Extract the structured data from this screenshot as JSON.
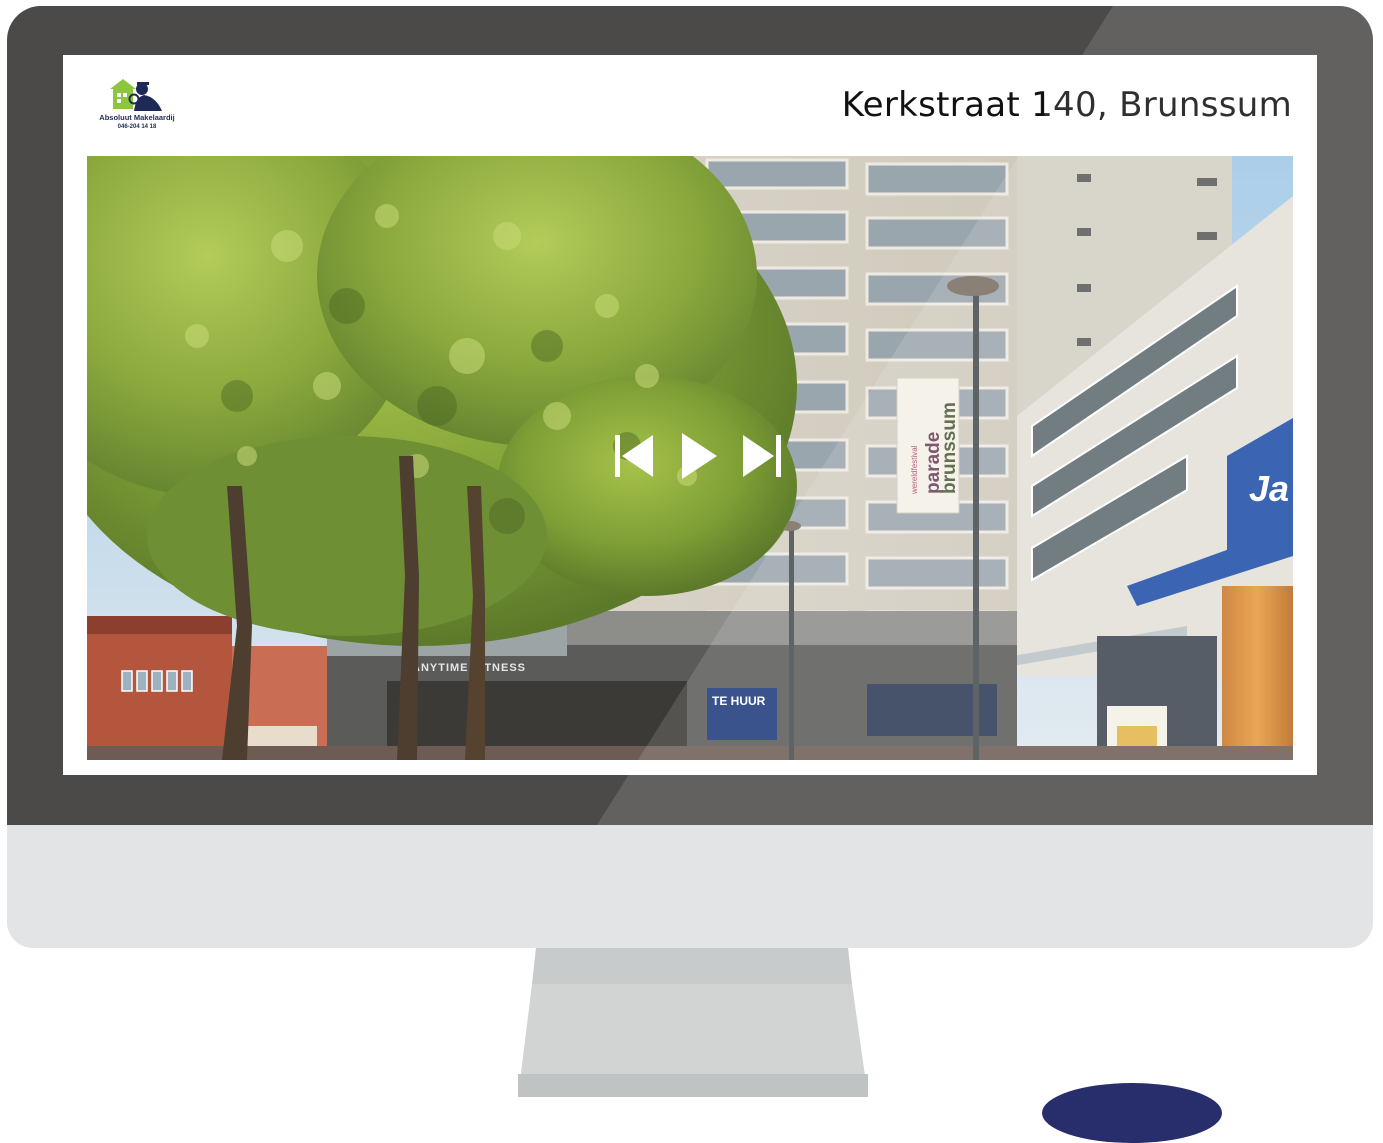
{
  "brand": {
    "name": "Absoluut Makelaardij",
    "phone": "046-204 14 18"
  },
  "listing": {
    "title": "Kerkstraat 140, Brunssum"
  },
  "slideshow": {
    "controls": [
      "previous",
      "play",
      "next"
    ]
  },
  "photo_signs": {
    "banner_line1": "parade",
    "banner_line2": "brunssum",
    "banner_small": "wereldfestival",
    "gym": "ANYTIME FITNESS",
    "rent_sign": "TE HUUR",
    "store_sign": "Ja"
  },
  "colors": {
    "bezel": "#4b4a48",
    "chin": "#e3e4e5",
    "stand": "#d2d4d4",
    "brand_green": "#8cc63f",
    "brand_navy": "#1d2a57"
  }
}
